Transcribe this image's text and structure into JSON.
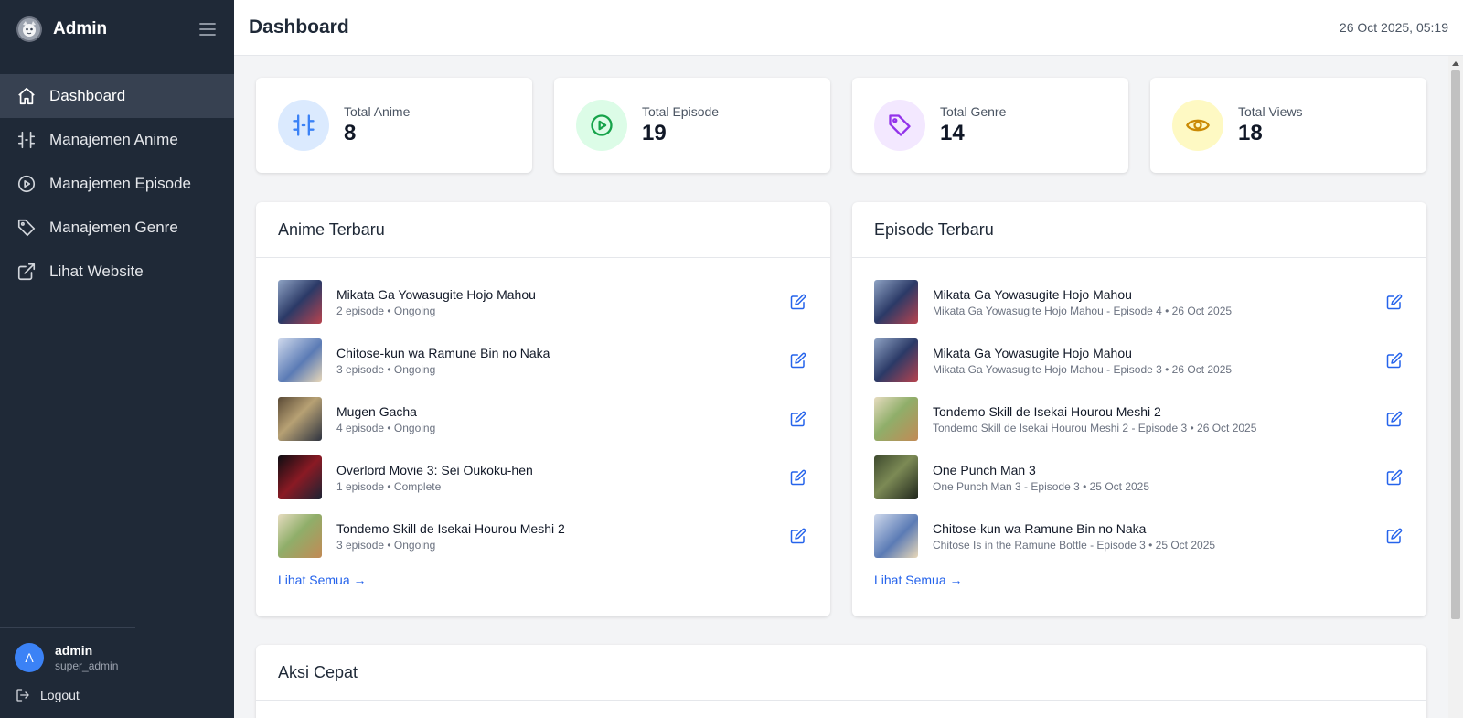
{
  "sidebar": {
    "brand": "Admin",
    "items": [
      {
        "label": "Dashboard"
      },
      {
        "label": "Manajemen Anime"
      },
      {
        "label": "Manajemen Episode"
      },
      {
        "label": "Manajemen Genre"
      },
      {
        "label": "Lihat Website"
      }
    ],
    "user": {
      "initial": "A",
      "name": "admin",
      "role": "super_admin"
    },
    "logout": "Logout"
  },
  "header": {
    "title": "Dashboard",
    "datetime": "26 Oct 2025, 05:19"
  },
  "stats": [
    {
      "label": "Total Anime",
      "value": "8",
      "icon": "film-icon",
      "color": "#3b82f6",
      "bg": "#dbeafe"
    },
    {
      "label": "Total Episode",
      "value": "19",
      "icon": "play-circle-icon",
      "color": "#16a34a",
      "bg": "#dcfce7"
    },
    {
      "label": "Total Genre",
      "value": "14",
      "icon": "tag-icon",
      "color": "#9333ea",
      "bg": "#f3e8ff"
    },
    {
      "label": "Total Views",
      "value": "18",
      "icon": "eye-icon",
      "color": "#ca8a04",
      "bg": "#fef9c3"
    }
  ],
  "anime_panel": {
    "title": "Anime Terbaru",
    "items": [
      {
        "title": "Mikata Ga Yowasugite Hojo Mahou",
        "sub": "2 episode • Ongoing"
      },
      {
        "title": "Chitose-kun wa Ramune Bin no Naka",
        "sub": "3 episode • Ongoing"
      },
      {
        "title": "Mugen Gacha",
        "sub": "4 episode • Ongoing"
      },
      {
        "title": "Overlord Movie 3: Sei Oukoku-hen",
        "sub": "1 episode • Complete"
      },
      {
        "title": "Tondemo Skill de Isekai Hourou Meshi 2",
        "sub": "3 episode • Ongoing"
      }
    ],
    "see_all": "Lihat Semua →"
  },
  "episode_panel": {
    "title": "Episode Terbaru",
    "items": [
      {
        "title": "Mikata Ga Yowasugite Hojo Mahou",
        "sub": "Mikata Ga Yowasugite Hojo Mahou - Episode 4 • 26 Oct 2025"
      },
      {
        "title": "Mikata Ga Yowasugite Hojo Mahou",
        "sub": "Mikata Ga Yowasugite Hojo Mahou - Episode 3 • 26 Oct 2025"
      },
      {
        "title": "Tondemo Skill de Isekai Hourou Meshi 2",
        "sub": "Tondemo Skill de Isekai Hourou Meshi 2 - Episode 3 • 26 Oct 2025"
      },
      {
        "title": "One Punch Man 3",
        "sub": "One Punch Man 3 - Episode 3 • 25 Oct 2025"
      },
      {
        "title": "Chitose-kun wa Ramune Bin no Naka",
        "sub": "Chitose Is in the Ramune Bottle - Episode 3 • 25 Oct 2025"
      }
    ],
    "see_all": "Lihat Semua →"
  },
  "quick_actions": {
    "title": "Aksi Cepat"
  }
}
